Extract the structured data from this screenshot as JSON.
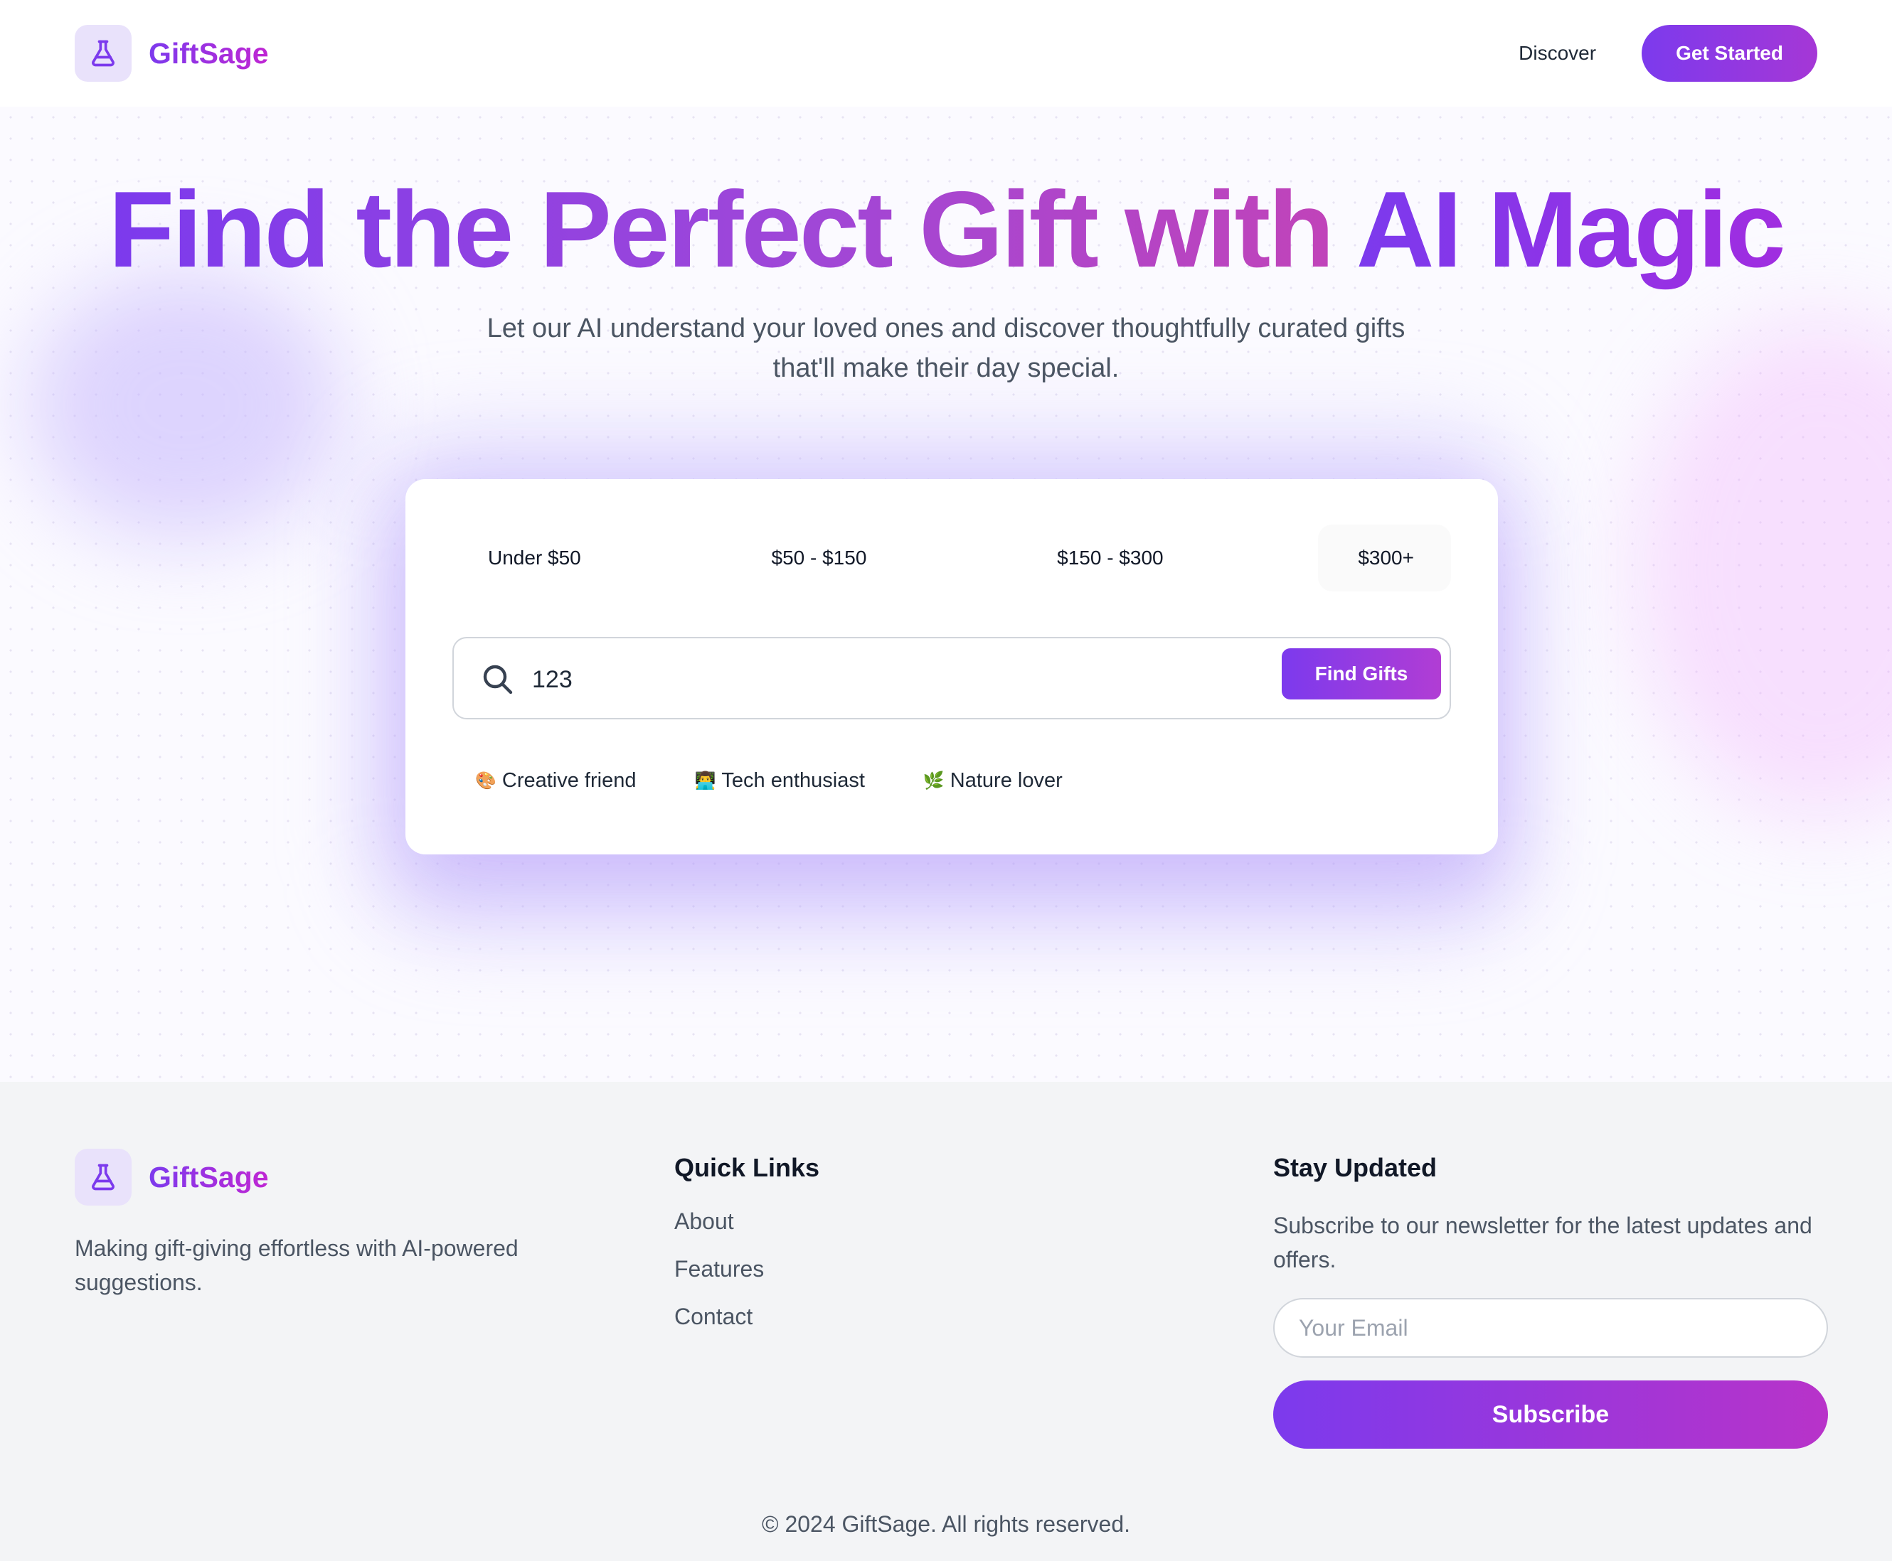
{
  "header": {
    "brand": "GiftSage",
    "logo_icon": "flask-icon",
    "nav_discover": "Discover",
    "cta": "Get Started"
  },
  "hero": {
    "title_part1": "Find the Perfect Gift with ",
    "title_part2": "AI Magic",
    "subtitle": "Let our AI understand your loved ones and discover thoughtfully curated gifts that'll make their day special."
  },
  "search_card": {
    "budgets": [
      "Under $50",
      "$50 - $150",
      "$150 - $300",
      "$300+"
    ],
    "search_value": "123",
    "find_button": "Find Gifts",
    "suggestions": [
      {
        "emoji": "🎨",
        "label": "Creative friend"
      },
      {
        "emoji": "👨‍💻",
        "label": "Tech enthusiast"
      },
      {
        "emoji": "🌿",
        "label": "Nature lover"
      }
    ]
  },
  "footer": {
    "brand": "GiftSage",
    "description": "Making gift-giving effortless with AI-powered suggestions.",
    "quick_links_heading": "Quick Links",
    "links": [
      "About",
      "Features",
      "Contact"
    ],
    "newsletter_heading": "Stay Updated",
    "newsletter_text": "Subscribe to our newsletter for the latest updates and offers.",
    "email_placeholder": "Your Email",
    "subscribe_button": "Subscribe",
    "copyright": "© 2024 GiftSage. All rights reserved."
  },
  "colors": {
    "accent_start": "#7c3aed",
    "accent_end": "#c026d3",
    "logo_bg": "#e9e2fb",
    "footer_bg": "#f3f4f6"
  }
}
